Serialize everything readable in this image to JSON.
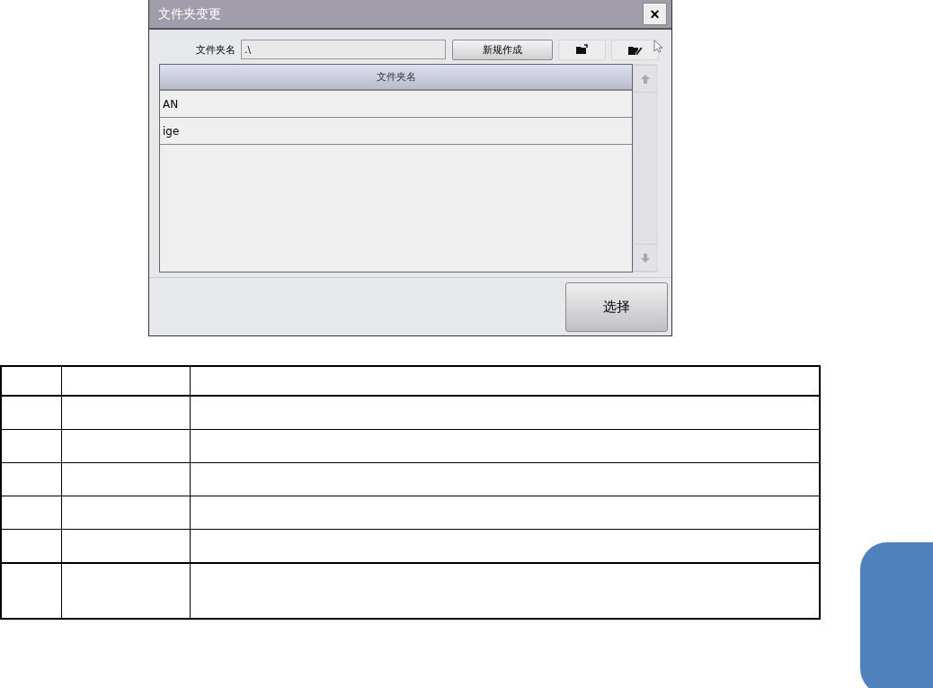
{
  "window": {
    "title": "文件夹变更",
    "close": "×"
  },
  "folder_field": {
    "label": "文件夹名",
    "value": ".\\"
  },
  "toolbar": {
    "new_button": "新规作成"
  },
  "folder_list": {
    "column": "文件夹名",
    "rows": [
      {
        "name": "AN",
        "selected": false
      },
      {
        "name": "ige",
        "selected": false
      }
    ]
  },
  "select_button": "选择"
}
